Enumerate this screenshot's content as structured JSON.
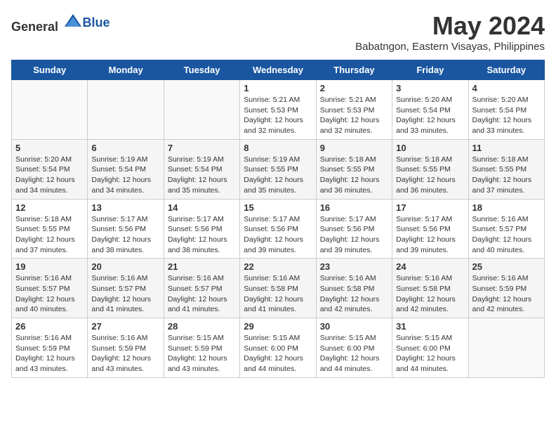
{
  "header": {
    "logo_general": "General",
    "logo_blue": "Blue",
    "main_title": "May 2024",
    "sub_title": "Babatngon, Eastern Visayas, Philippines"
  },
  "days_of_week": [
    "Sunday",
    "Monday",
    "Tuesday",
    "Wednesday",
    "Thursday",
    "Friday",
    "Saturday"
  ],
  "weeks": [
    {
      "days": [
        {
          "number": "",
          "info": ""
        },
        {
          "number": "",
          "info": ""
        },
        {
          "number": "",
          "info": ""
        },
        {
          "number": "1",
          "info": "Sunrise: 5:21 AM\nSunset: 5:53 PM\nDaylight: 12 hours\nand 32 minutes."
        },
        {
          "number": "2",
          "info": "Sunrise: 5:21 AM\nSunset: 5:53 PM\nDaylight: 12 hours\nand 32 minutes."
        },
        {
          "number": "3",
          "info": "Sunrise: 5:20 AM\nSunset: 5:54 PM\nDaylight: 12 hours\nand 33 minutes."
        },
        {
          "number": "4",
          "info": "Sunrise: 5:20 AM\nSunset: 5:54 PM\nDaylight: 12 hours\nand 33 minutes."
        }
      ]
    },
    {
      "days": [
        {
          "number": "5",
          "info": "Sunrise: 5:20 AM\nSunset: 5:54 PM\nDaylight: 12 hours\nand 34 minutes."
        },
        {
          "number": "6",
          "info": "Sunrise: 5:19 AM\nSunset: 5:54 PM\nDaylight: 12 hours\nand 34 minutes."
        },
        {
          "number": "7",
          "info": "Sunrise: 5:19 AM\nSunset: 5:54 PM\nDaylight: 12 hours\nand 35 minutes."
        },
        {
          "number": "8",
          "info": "Sunrise: 5:19 AM\nSunset: 5:55 PM\nDaylight: 12 hours\nand 35 minutes."
        },
        {
          "number": "9",
          "info": "Sunrise: 5:18 AM\nSunset: 5:55 PM\nDaylight: 12 hours\nand 36 minutes."
        },
        {
          "number": "10",
          "info": "Sunrise: 5:18 AM\nSunset: 5:55 PM\nDaylight: 12 hours\nand 36 minutes."
        },
        {
          "number": "11",
          "info": "Sunrise: 5:18 AM\nSunset: 5:55 PM\nDaylight: 12 hours\nand 37 minutes."
        }
      ]
    },
    {
      "days": [
        {
          "number": "12",
          "info": "Sunrise: 5:18 AM\nSunset: 5:55 PM\nDaylight: 12 hours\nand 37 minutes."
        },
        {
          "number": "13",
          "info": "Sunrise: 5:17 AM\nSunset: 5:56 PM\nDaylight: 12 hours\nand 38 minutes."
        },
        {
          "number": "14",
          "info": "Sunrise: 5:17 AM\nSunset: 5:56 PM\nDaylight: 12 hours\nand 38 minutes."
        },
        {
          "number": "15",
          "info": "Sunrise: 5:17 AM\nSunset: 5:56 PM\nDaylight: 12 hours\nand 39 minutes."
        },
        {
          "number": "16",
          "info": "Sunrise: 5:17 AM\nSunset: 5:56 PM\nDaylight: 12 hours\nand 39 minutes."
        },
        {
          "number": "17",
          "info": "Sunrise: 5:17 AM\nSunset: 5:56 PM\nDaylight: 12 hours\nand 39 minutes."
        },
        {
          "number": "18",
          "info": "Sunrise: 5:16 AM\nSunset: 5:57 PM\nDaylight: 12 hours\nand 40 minutes."
        }
      ]
    },
    {
      "days": [
        {
          "number": "19",
          "info": "Sunrise: 5:16 AM\nSunset: 5:57 PM\nDaylight: 12 hours\nand 40 minutes."
        },
        {
          "number": "20",
          "info": "Sunrise: 5:16 AM\nSunset: 5:57 PM\nDaylight: 12 hours\nand 41 minutes."
        },
        {
          "number": "21",
          "info": "Sunrise: 5:16 AM\nSunset: 5:57 PM\nDaylight: 12 hours\nand 41 minutes."
        },
        {
          "number": "22",
          "info": "Sunrise: 5:16 AM\nSunset: 5:58 PM\nDaylight: 12 hours\nand 41 minutes."
        },
        {
          "number": "23",
          "info": "Sunrise: 5:16 AM\nSunset: 5:58 PM\nDaylight: 12 hours\nand 42 minutes."
        },
        {
          "number": "24",
          "info": "Sunrise: 5:16 AM\nSunset: 5:58 PM\nDaylight: 12 hours\nand 42 minutes."
        },
        {
          "number": "25",
          "info": "Sunrise: 5:16 AM\nSunset: 5:59 PM\nDaylight: 12 hours\nand 42 minutes."
        }
      ]
    },
    {
      "days": [
        {
          "number": "26",
          "info": "Sunrise: 5:16 AM\nSunset: 5:59 PM\nDaylight: 12 hours\nand 43 minutes."
        },
        {
          "number": "27",
          "info": "Sunrise: 5:16 AM\nSunset: 5:59 PM\nDaylight: 12 hours\nand 43 minutes."
        },
        {
          "number": "28",
          "info": "Sunrise: 5:15 AM\nSunset: 5:59 PM\nDaylight: 12 hours\nand 43 minutes."
        },
        {
          "number": "29",
          "info": "Sunrise: 5:15 AM\nSunset: 6:00 PM\nDaylight: 12 hours\nand 44 minutes."
        },
        {
          "number": "30",
          "info": "Sunrise: 5:15 AM\nSunset: 6:00 PM\nDaylight: 12 hours\nand 44 minutes."
        },
        {
          "number": "31",
          "info": "Sunrise: 5:15 AM\nSunset: 6:00 PM\nDaylight: 12 hours\nand 44 minutes."
        },
        {
          "number": "",
          "info": ""
        }
      ]
    }
  ]
}
